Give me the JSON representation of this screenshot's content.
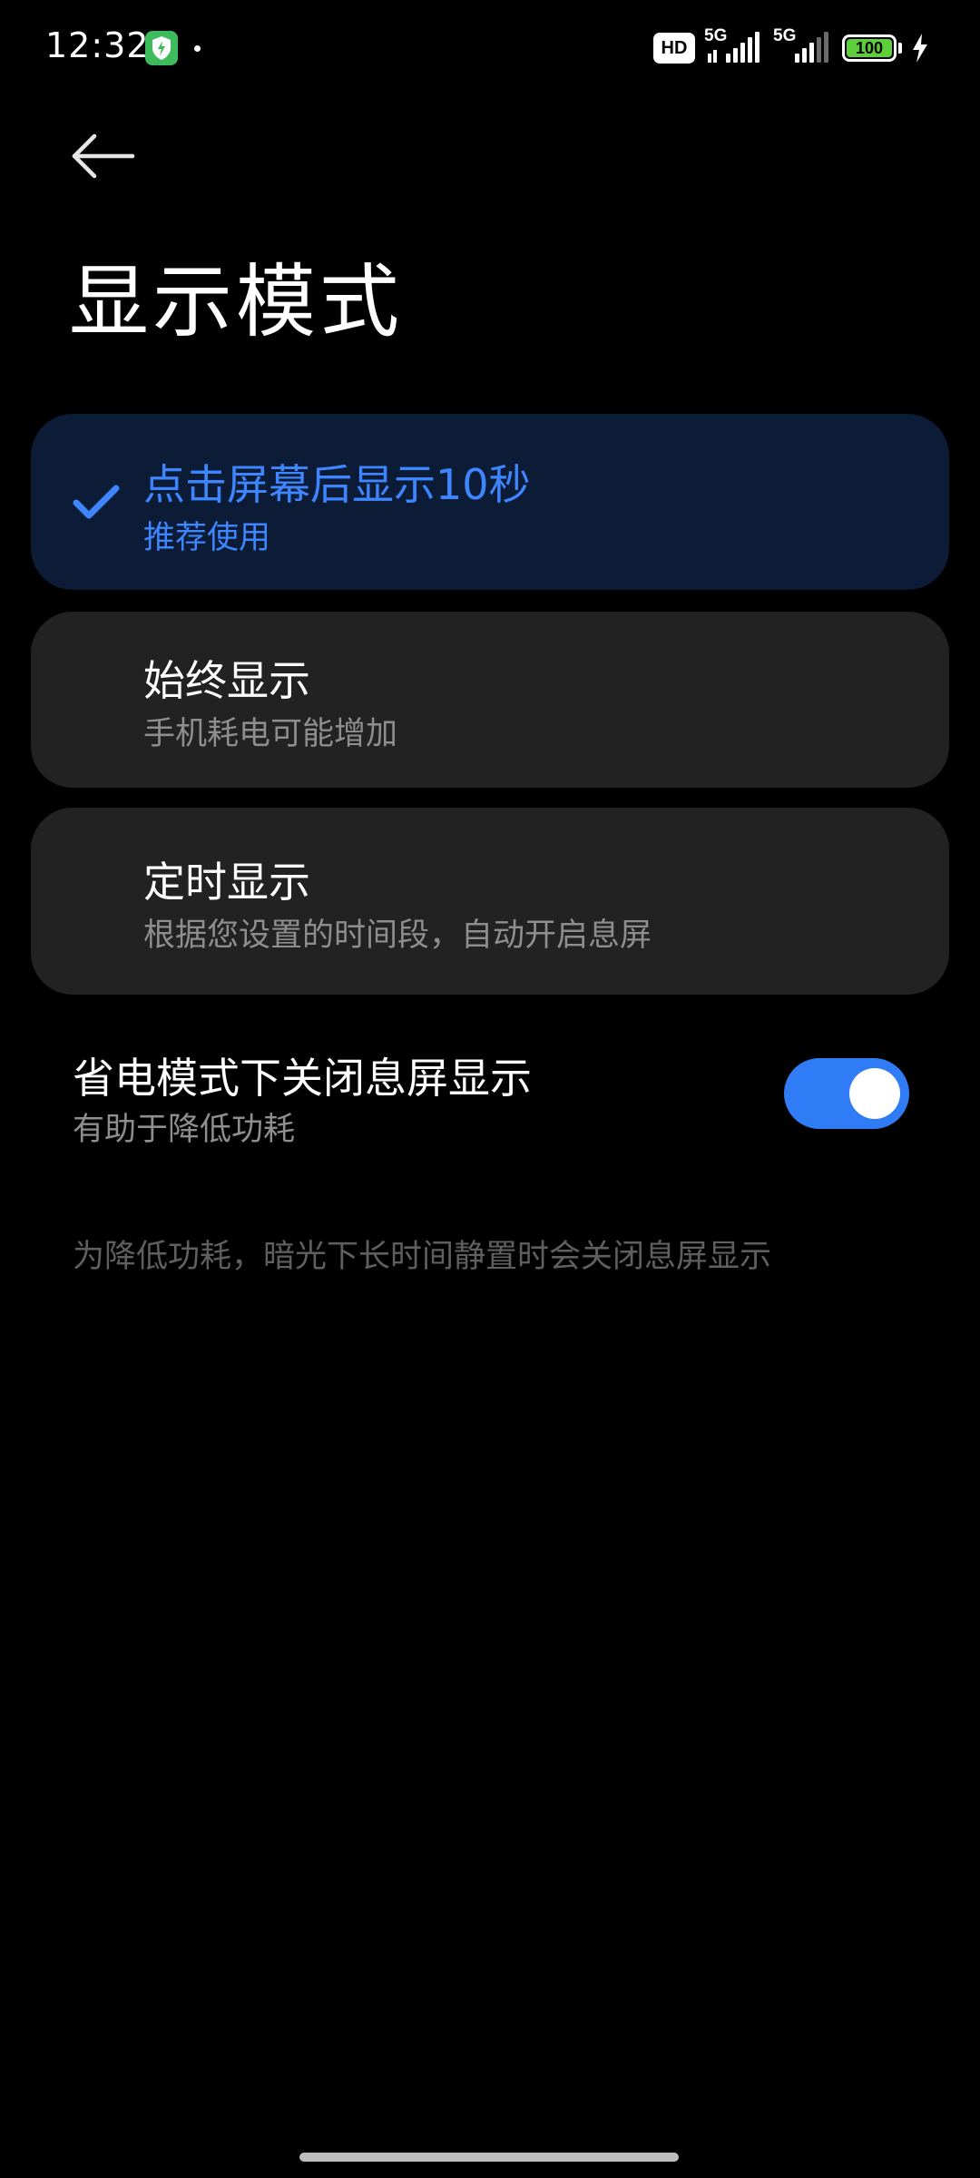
{
  "status_bar": {
    "time": "12:32",
    "hd_label": "HD",
    "network_1": "5G",
    "network_2": "5G",
    "battery_level": "100",
    "battery_color": "#5ccf3a",
    "icons": [
      "security-shield-icon",
      "notification-dot-icon",
      "hd-voice-icon",
      "signal-5g-icon",
      "signal-5g-icon",
      "battery-icon",
      "charging-bolt-icon"
    ]
  },
  "header": {
    "back_icon": "back-arrow-icon",
    "title": "显示模式"
  },
  "options": [
    {
      "title": "点击屏幕后显示10秒",
      "subtitle": "推荐使用",
      "selected": true
    },
    {
      "title": "始终显示",
      "subtitle": "手机耗电可能增加",
      "selected": false
    },
    {
      "title": "定时显示",
      "subtitle": "根据您设置的时间段，自动开启息屏",
      "selected": false
    }
  ],
  "power_saving": {
    "title": "省电模式下关闭息屏显示",
    "subtitle": "有助于降低功耗",
    "enabled": true
  },
  "footnote": "为降低功耗，暗光下长时间静置时会关闭息屏显示",
  "colors": {
    "accent": "#3d86ff",
    "toggle_on": "#2f7cf6",
    "selected_card": "#0c1b36",
    "card": "#222222"
  }
}
